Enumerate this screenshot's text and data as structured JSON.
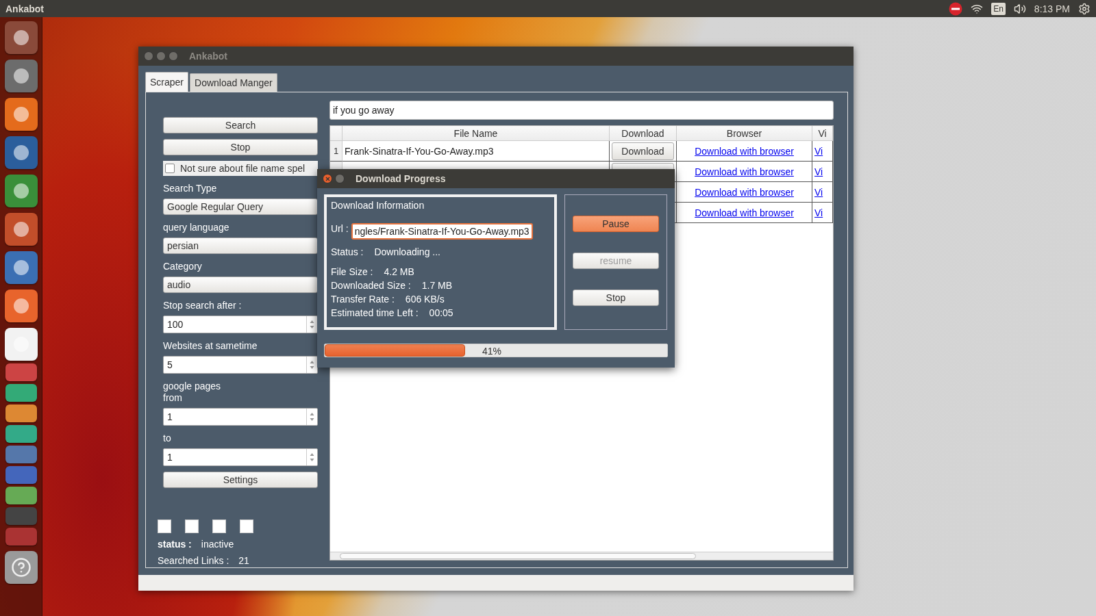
{
  "top_bar": {
    "app_name": "Ankabot",
    "keyboard_layout": "En",
    "clock": "8:13 PM"
  },
  "window": {
    "title": "Ankabot"
  },
  "tabs": [
    {
      "label": "Scraper",
      "selected": true
    },
    {
      "label": "Download Manger",
      "selected": false
    }
  ],
  "scraper": {
    "search_button": "Search",
    "stop_button": "Stop",
    "settings_button": "Settings",
    "spell_checkbox": {
      "label": "Not sure about file name spel",
      "checked": false
    },
    "fields": [
      {
        "kind": "combo",
        "label": "Search Type",
        "value": "Google Regular Query"
      },
      {
        "kind": "combo",
        "label": "query language",
        "value": "persian"
      },
      {
        "kind": "combo",
        "label": "Category",
        "value": "audio"
      },
      {
        "kind": "spin",
        "label": "Stop search after :",
        "value": "100"
      },
      {
        "kind": "spin",
        "label": "Websites at sametime",
        "value": "5"
      },
      {
        "kind": "spin",
        "label": "google pages\nfrom",
        "value": "1"
      },
      {
        "kind": "spin",
        "label": "to",
        "value": "1"
      }
    ],
    "status": {
      "label": "status :",
      "value": "inactive"
    },
    "searched_links": {
      "label": "Searched Links :",
      "value": "21"
    }
  },
  "search_query": "if you go away",
  "table": {
    "columns": [
      "File Name",
      "Download",
      "Browser",
      "Vi"
    ],
    "rows": [
      {
        "number": "1",
        "file_name": "Frank-Sinatra-If-You-Go-Away.mp3",
        "download": "Download",
        "browser_link": "Download with browser",
        "column_5": "Vi"
      },
      {
        "browser_link": "Download with browser",
        "column_5": "Vi"
      },
      {
        "browser_link": "Download with browser",
        "column_5": "Vi"
      },
      {
        "browser_link": "Download with browser",
        "column_5": "Vi"
      }
    ]
  },
  "dialog": {
    "title": "Download Progress",
    "group_title": "Download Information",
    "url_label": "Url :",
    "url": "ngles/Frank-Sinatra-If-You-Go-Away.mp3",
    "status": {
      "label": "Status :",
      "value": "Downloading ..."
    },
    "details": [
      {
        "label": "File Size :",
        "value": "4.2 MB"
      },
      {
        "label": "Downloaded Size :",
        "value": "1.7 MB"
      },
      {
        "label": "Transfer Rate :",
        "value": "606 KB/s"
      },
      {
        "label": "Estimated time Left :",
        "value": "00:05"
      }
    ],
    "buttons": [
      {
        "label": "Pause",
        "default": true,
        "disabled": false
      },
      {
        "label": "resume",
        "default": false,
        "disabled": true
      },
      {
        "label": "Stop",
        "default": false,
        "disabled": false
      }
    ],
    "progress": {
      "level": 0.41,
      "text": "41%"
    }
  }
}
